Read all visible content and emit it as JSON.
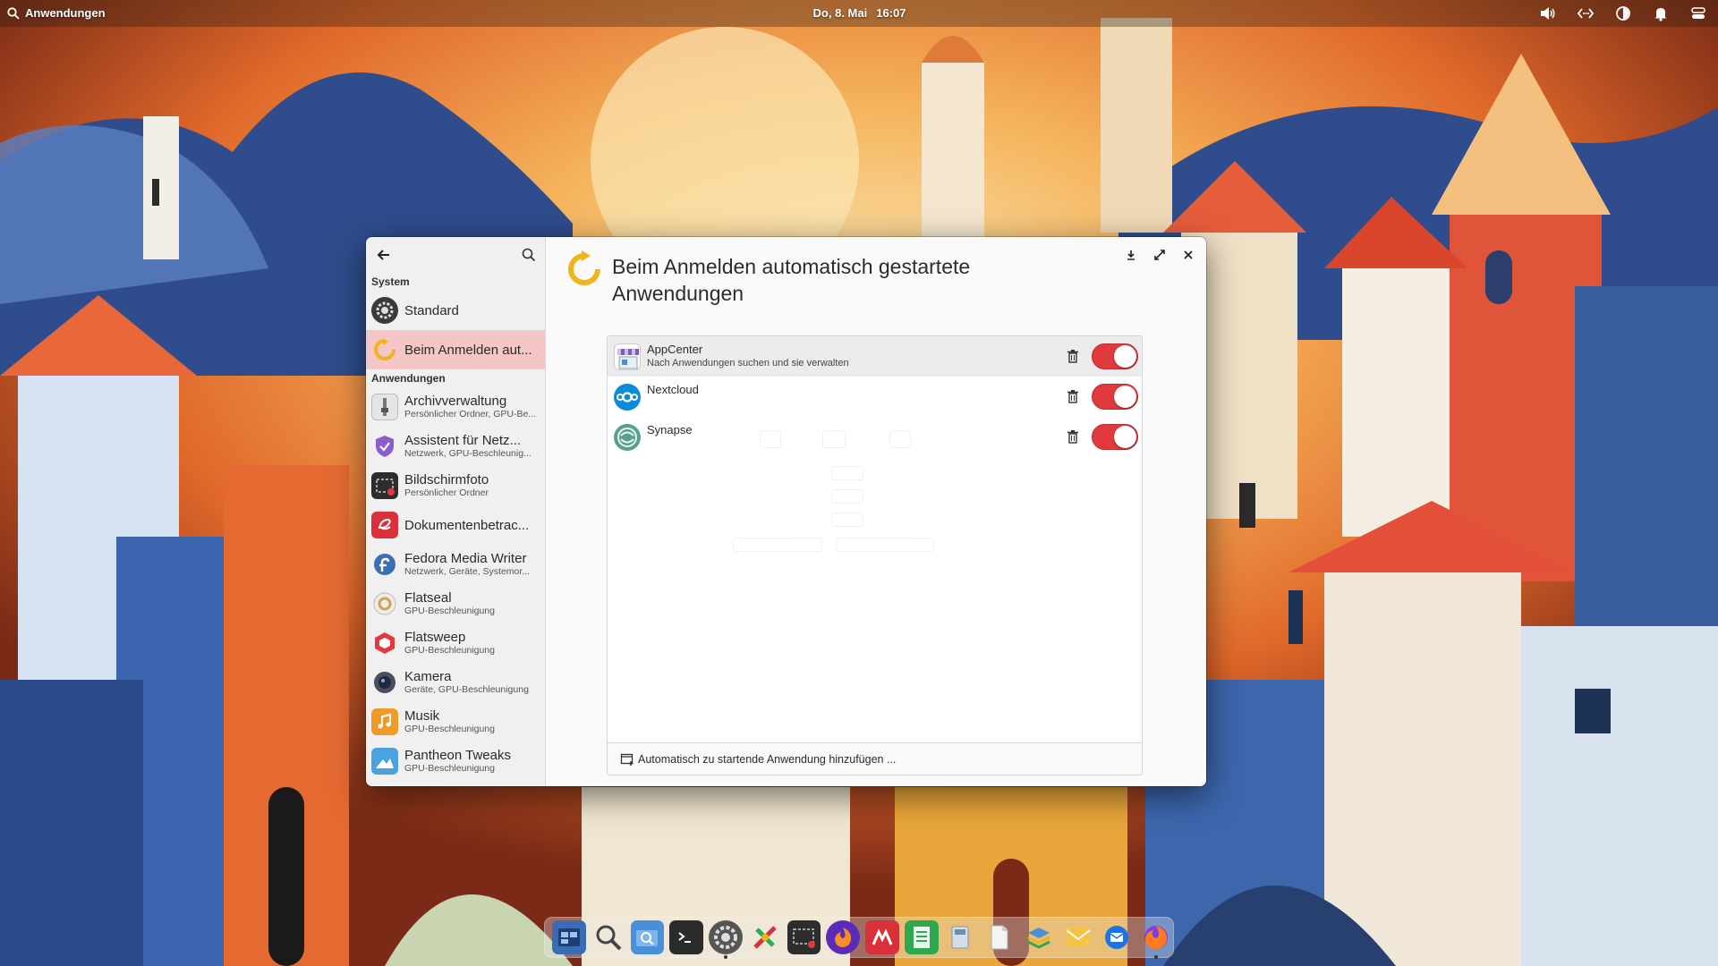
{
  "panel": {
    "applications_label": "Anwendungen",
    "date": "Do,  8. Mai",
    "time": "16:07"
  },
  "window": {
    "title": "Beim Anmelden automatisch gestartete Anwendungen",
    "sidebar": {
      "section_system": "System",
      "section_apps": "Anwendungen",
      "system_items": [
        {
          "title": "Standard",
          "subtitle": ""
        },
        {
          "title": "Beim Anmelden aut...",
          "subtitle": ""
        }
      ],
      "app_items": [
        {
          "title": "Archivverwaltung",
          "subtitle": "Persönlicher Ordner, GPU-Be..."
        },
        {
          "title": "Assistent für Netz...",
          "subtitle": "Netzwerk, GPU-Beschleunig..."
        },
        {
          "title": "Bildschirmfoto",
          "subtitle": "Persönlicher Ordner"
        },
        {
          "title": "Dokumentenbetrac...",
          "subtitle": ""
        },
        {
          "title": "Fedora Media Writer",
          "subtitle": "Netzwerk, Geräte, Systemor..."
        },
        {
          "title": "Flatseal",
          "subtitle": "GPU-Beschleunigung"
        },
        {
          "title": "Flatsweep",
          "subtitle": "GPU-Beschleunigung"
        },
        {
          "title": "Kamera",
          "subtitle": "Geräte, GPU-Beschleunigung"
        },
        {
          "title": "Musik",
          "subtitle": "GPU-Beschleunigung"
        },
        {
          "title": "Pantheon Tweaks",
          "subtitle": "GPU-Beschleunigung"
        }
      ]
    },
    "startup_apps": [
      {
        "name": "AppCenter",
        "description": "Nach Anwendungen suchen und sie verwalten",
        "enabled": true
      },
      {
        "name": "Nextcloud",
        "description": "",
        "enabled": true
      },
      {
        "name": "Synapse",
        "description": "",
        "enabled": true
      }
    ],
    "add_button_label": "Automatisch zu startende Anwendung hinzufügen ..."
  },
  "colors": {
    "accent_red": "#e0393e",
    "selected_sidebar": "#f4c6c6",
    "refresh_icon": "#f0b41e"
  },
  "icons": {
    "panel": [
      "search-icon",
      "volume-icon",
      "network-icon",
      "night-light-icon",
      "notifications-icon",
      "session-icon"
    ],
    "window_controls": [
      "download-icon",
      "maximize-icon",
      "close-icon"
    ],
    "dock": [
      "multitasking-view",
      "search",
      "files",
      "terminal",
      "system-settings",
      "flatseal",
      "screenshot",
      "firefox-dev",
      "document-viewer",
      "spreadsheet",
      "disk-utility",
      "text-editor",
      "layers",
      "mail",
      "thunderbird",
      "firefox"
    ]
  }
}
